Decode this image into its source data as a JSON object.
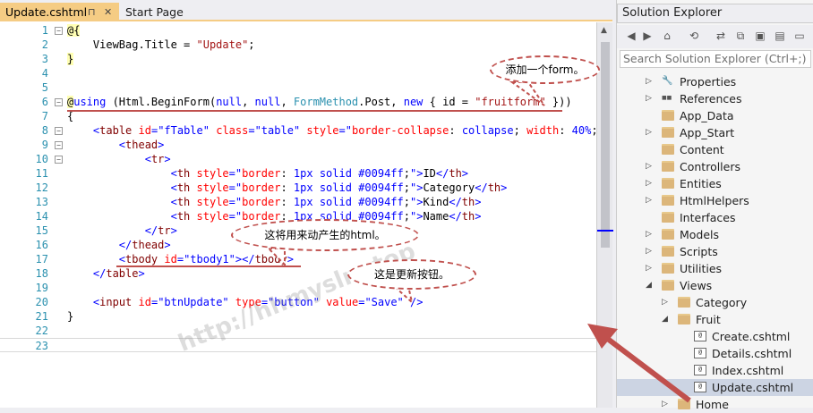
{
  "editor": {
    "tabs": [
      {
        "label": "Update.cshtml",
        "active": true,
        "pin": "⊓",
        "close": "✕"
      },
      {
        "label": "Start Page",
        "active": false
      }
    ],
    "lines": [
      {
        "n": "1",
        "html": "<span class='t-at'>@{</span>"
      },
      {
        "n": "2",
        "html": "    ViewBag.Title = <span class='t-str'>\"Update\"</span>;"
      },
      {
        "n": "3",
        "html": "<span class='t-at'>}</span>"
      },
      {
        "n": "4",
        "html": ""
      },
      {
        "n": "5",
        "html": ""
      },
      {
        "n": "6",
        "html": "<span class='t-at'>@</span><span class='t-kw'>using</span> (Html.BeginForm(<span class='t-kw'>null</span>, <span class='t-kw'>null</span>, <span class='t-type'>FormMethod</span>.Post, <span class='t-kw'>new</span> { id = <span class='t-str'>\"fruitform\"</span> }))"
      },
      {
        "n": "7",
        "html": "{"
      },
      {
        "n": "8",
        "html": "    <span class='t-punct'>&lt;</span><span class='t-tag'>table</span> <span class='t-attr'>id</span><span class='t-punct'>=</span><span class='t-punct'>\"fTable\"</span> <span class='t-attr'>class</span><span class='t-punct'>=</span><span class='t-punct'>\"table\"</span> <span class='t-attr'>style</span><span class='t-punct'>=</span><span class='t-punct'>\"</span><span class='t-attr'>border-collapse</span>: <span class='t-punct'>collapse</span>; <span class='t-attr'>width</span>: <span class='t-punct'>40%</span>;<span class='t-punct'>\"&gt;</span>"
      },
      {
        "n": "9",
        "html": "        <span class='t-punct'>&lt;</span><span class='t-tag'>thead</span><span class='t-punct'>&gt;</span>"
      },
      {
        "n": "10",
        "html": "            <span class='t-punct'>&lt;</span><span class='t-tag'>tr</span><span class='t-punct'>&gt;</span>"
      },
      {
        "n": "11",
        "html": "                <span class='t-punct'>&lt;</span><span class='t-tag'>th</span> <span class='t-attr'>style</span><span class='t-punct'>=</span><span class='t-punct'>\"</span><span class='t-attr'>border</span>: <span class='t-punct'>1px solid #0094ff</span>;<span class='t-punct'>\"&gt;</span>ID<span class='t-punct'>&lt;/</span><span class='t-tag'>th</span><span class='t-punct'>&gt;</span>"
      },
      {
        "n": "12",
        "html": "                <span class='t-punct'>&lt;</span><span class='t-tag'>th</span> <span class='t-attr'>style</span><span class='t-punct'>=</span><span class='t-punct'>\"</span><span class='t-attr'>border</span>: <span class='t-punct'>1px solid #0094ff</span>;<span class='t-punct'>\"&gt;</span>Category<span class='t-punct'>&lt;/</span><span class='t-tag'>th</span><span class='t-punct'>&gt;</span>"
      },
      {
        "n": "13",
        "html": "                <span class='t-punct'>&lt;</span><span class='t-tag'>th</span> <span class='t-attr'>style</span><span class='t-punct'>=</span><span class='t-punct'>\"</span><span class='t-attr'>border</span>: <span class='t-punct'>1px solid #0094ff</span>;<span class='t-punct'>\"&gt;</span>Kind<span class='t-punct'>&lt;/</span><span class='t-tag'>th</span><span class='t-punct'>&gt;</span>"
      },
      {
        "n": "14",
        "html": "                <span class='t-punct'>&lt;</span><span class='t-tag'>th</span> <span class='t-attr'>style</span><span class='t-punct'>=</span><span class='t-punct'>\"</span><span class='t-attr'>border</span>: <span class='t-punct'>1px solid #0094ff</span>;<span class='t-punct'>\"&gt;</span>Name<span class='t-punct'>&lt;/</span><span class='t-tag'>th</span><span class='t-punct'>&gt;</span>"
      },
      {
        "n": "15",
        "html": "            <span class='t-punct'>&lt;/</span><span class='t-tag'>tr</span><span class='t-punct'>&gt;</span>"
      },
      {
        "n": "16",
        "html": "        <span class='t-punct'>&lt;/</span><span class='t-tag'>thead</span><span class='t-punct'>&gt;</span>"
      },
      {
        "n": "17",
        "html": "        <span class='t-punct'>&lt;</span><span class='t-tag'>tbody</span> <span class='t-attr'>id</span><span class='t-punct'>=</span><span class='t-punct'>\"tbody1\"</span><span class='t-punct'>&gt;&lt;/</span><span class='t-tag'>tbody</span><span class='t-punct'>&gt;</span>"
      },
      {
        "n": "18",
        "html": "    <span class='t-punct'>&lt;/</span><span class='t-tag'>table</span><span class='t-punct'>&gt;</span>"
      },
      {
        "n": "19",
        "html": ""
      },
      {
        "n": "20",
        "html": "    <span class='t-punct'>&lt;</span><span class='t-tag'>input</span> <span class='t-attr'>id</span><span class='t-punct'>=</span><span class='t-punct'>\"btnUpdate\"</span> <span class='t-attr'>type</span><span class='t-punct'>=</span><span class='t-punct'>\"button\"</span> <span class='t-attr'>value</span><span class='t-punct'>=</span><span class='t-punct'>\"Save\"</span> <span class='t-punct'>/&gt;</span>"
      },
      {
        "n": "21",
        "html": "}"
      },
      {
        "n": "22",
        "html": ""
      },
      {
        "n": "23",
        "html": ""
      }
    ]
  },
  "solution_explorer": {
    "title": "Solution Explorer",
    "search_placeholder": "Search Solution Explorer (Ctrl+;)",
    "toolbar_icons": [
      "back-icon",
      "forward-icon",
      "home-icon",
      "history-icon",
      "sync-icon",
      "collapse-all-icon",
      "show-all-files-icon",
      "properties-icon",
      "preview-icon"
    ],
    "tree": [
      {
        "label": "Properties",
        "indent": 0,
        "expander": "▷",
        "icon": "wrench-icon"
      },
      {
        "label": "References",
        "indent": 0,
        "expander": "▷",
        "icon": "references-icon"
      },
      {
        "label": "App_Data",
        "indent": 0,
        "expander": "",
        "icon": "folder-icon"
      },
      {
        "label": "App_Start",
        "indent": 0,
        "expander": "▷",
        "icon": "folder-icon"
      },
      {
        "label": "Content",
        "indent": 0,
        "expander": "",
        "icon": "folder-icon"
      },
      {
        "label": "Controllers",
        "indent": 0,
        "expander": "▷",
        "icon": "folder-icon"
      },
      {
        "label": "Entities",
        "indent": 0,
        "expander": "▷",
        "icon": "folder-icon"
      },
      {
        "label": "HtmlHelpers",
        "indent": 0,
        "expander": "▷",
        "icon": "folder-icon"
      },
      {
        "label": "Interfaces",
        "indent": 0,
        "expander": "",
        "icon": "folder-icon"
      },
      {
        "label": "Models",
        "indent": 0,
        "expander": "▷",
        "icon": "folder-icon"
      },
      {
        "label": "Scripts",
        "indent": 0,
        "expander": "▷",
        "icon": "folder-icon"
      },
      {
        "label": "Utilities",
        "indent": 0,
        "expander": "▷",
        "icon": "folder-icon"
      },
      {
        "label": "Views",
        "indent": 0,
        "expander": "◢",
        "icon": "folder-open-icon"
      },
      {
        "label": "Category",
        "indent": 1,
        "expander": "▷",
        "icon": "folder-icon"
      },
      {
        "label": "Fruit",
        "indent": 1,
        "expander": "◢",
        "icon": "folder-open-icon"
      },
      {
        "label": "Create.cshtml",
        "indent": 2,
        "expander": "",
        "icon": "cshtml-file-icon"
      },
      {
        "label": "Details.cshtml",
        "indent": 2,
        "expander": "",
        "icon": "cshtml-file-icon"
      },
      {
        "label": "Index.cshtml",
        "indent": 2,
        "expander": "",
        "icon": "cshtml-file-icon"
      },
      {
        "label": "Update.cshtml",
        "indent": 2,
        "expander": "",
        "icon": "cshtml-file-icon",
        "selected": true
      },
      {
        "label": "Home",
        "indent": 1,
        "expander": "▷",
        "icon": "folder-icon"
      }
    ]
  },
  "annotations": {
    "form_note": "添加一个form。",
    "tbody_note": "这将用来动产生的html。",
    "button_note": "这是更新按钮。",
    "watermark": "http://hhmyslm.top",
    "accent_color": "#c0504d"
  }
}
